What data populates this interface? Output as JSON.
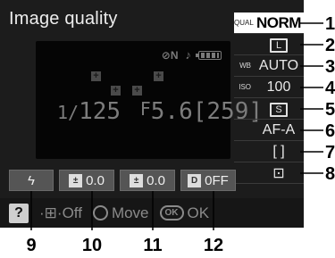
{
  "title": "Image quality",
  "viewfinder": {
    "top_left_symbol": "⊘N",
    "note_symbol": "♪",
    "af_point_glyph": "+",
    "shutter_prefix": "1/",
    "shutter": "125",
    "aperture_prefix": "F",
    "aperture": "5.6",
    "frames": "[259]"
  },
  "panel": [
    {
      "label": "QUAL",
      "value": "NORM"
    },
    {
      "label": "",
      "value": "L"
    },
    {
      "label": "WB",
      "value": "AUTO"
    },
    {
      "label": "ISO",
      "value": "100"
    },
    {
      "label": "",
      "value": "S"
    },
    {
      "label": "",
      "value": "AF-A"
    },
    {
      "label": "",
      "value": "[ ]"
    },
    {
      "label": "",
      "value": "⊡"
    }
  ],
  "bottom": [
    {
      "icon": "ϟ",
      "value": ""
    },
    {
      "icon": "±",
      "value": "0.0"
    },
    {
      "icon": "±",
      "value": "0.0"
    },
    {
      "icon": "D",
      "value": "0FF"
    }
  ],
  "help": {
    "q_label": "?",
    "info_label": "·⊞·Off",
    "move_label": "Move",
    "ok_badge": "OK",
    "ok_label": "OK"
  },
  "callouts": [
    "1",
    "2",
    "3",
    "4",
    "5",
    "6",
    "7",
    "8",
    "9",
    "10",
    "11",
    "12"
  ]
}
